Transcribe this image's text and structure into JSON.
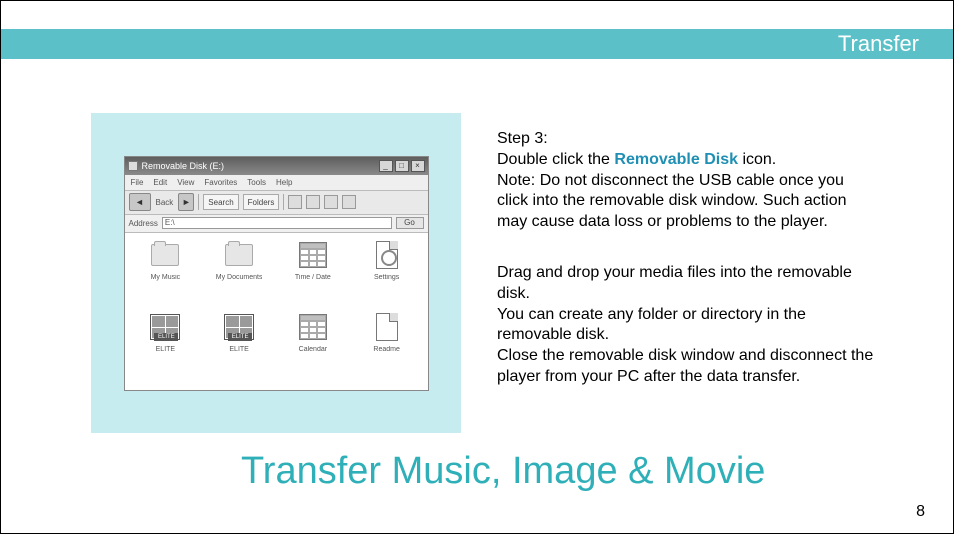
{
  "header": {
    "label": "Transfer"
  },
  "window": {
    "title": "Removable Disk (E:)",
    "menu": [
      "File",
      "Edit",
      "View",
      "Favorites",
      "Tools",
      "Help"
    ],
    "toolbar": {
      "back": "Back",
      "search": "Search",
      "folders": "Folders"
    },
    "address": {
      "label": "Address",
      "value": "E:\\",
      "go": "Go"
    },
    "icons": [
      {
        "label": "My Music",
        "kind": "folder"
      },
      {
        "label": "My Documents",
        "kind": "folder"
      },
      {
        "label": "Time / Date",
        "kind": "cal"
      },
      {
        "label": "Settings",
        "kind": "page-gear"
      },
      {
        "label": "ELITE",
        "kind": "thumb"
      },
      {
        "label": "ELITE",
        "kind": "thumb"
      },
      {
        "label": "Calendar",
        "kind": "cal"
      },
      {
        "label": "Readme",
        "kind": "page"
      }
    ]
  },
  "instructions": {
    "step_label": "Step 3:",
    "line1a": "Double click the ",
    "highlight": "Removable Disk",
    "line1b": " icon.",
    "note": "Note: Do not disconnect the USB cable once you click into the removable disk window. Such action may cause data loss or problems to the player.",
    "p2a": "Drag and drop your media files into the removable disk.",
    "p2b": "You can create any folder or directory in the removable disk.",
    "p2c": "Close the removable disk window and disconnect the player from your PC after the data transfer."
  },
  "title": "Transfer Music, Image & Movie",
  "page_number": "8"
}
